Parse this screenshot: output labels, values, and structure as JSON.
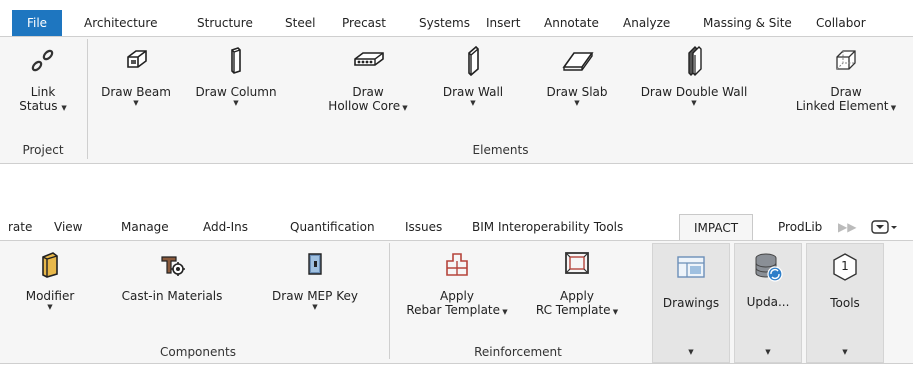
{
  "top": {
    "tabs": [
      "File",
      "Architecture",
      "Structure",
      "Steel",
      "Precast",
      "Systems",
      "Insert",
      "Annotate",
      "Analyze",
      "Massing & Site",
      "Collabor"
    ],
    "buttons": {
      "link_status": [
        "Link",
        "Status"
      ],
      "draw_beam": "Draw Beam",
      "draw_column": "Draw Column",
      "draw_hollow_core": [
        "Draw",
        "Hollow Core"
      ],
      "draw_wall": "Draw Wall",
      "draw_slab": "Draw Slab",
      "draw_double_wall": "Draw Double Wall",
      "draw_linked_element": [
        "Draw",
        "Linked Element"
      ]
    },
    "panels": {
      "project": "Project",
      "elements": "Elements"
    }
  },
  "bottom": {
    "tabs": [
      "rate",
      "View",
      "Manage",
      "Add-Ins",
      "Quantification",
      "Issues",
      "BIM Interoperability Tools",
      "IMPACT",
      "ProdLib"
    ],
    "buttons": {
      "modifier": "Modifier",
      "cast_in_materials": "Cast-in Materials",
      "draw_mep_key": "Draw MEP Key",
      "apply_rebar_template": [
        "Apply",
        "Rebar Template"
      ],
      "apply_rc_template": [
        "Apply",
        "RC Template"
      ],
      "drawings": "Drawings",
      "update": "Upda...",
      "tools": "Tools",
      "tools_badge": "1"
    },
    "panels": {
      "components": "Components",
      "reinforcement": "Reinforcement"
    }
  },
  "colors": {
    "file_tab": "#1e76c0",
    "panel_bg": "#f6f6f6",
    "accent_yellow": "#e8b84a"
  }
}
